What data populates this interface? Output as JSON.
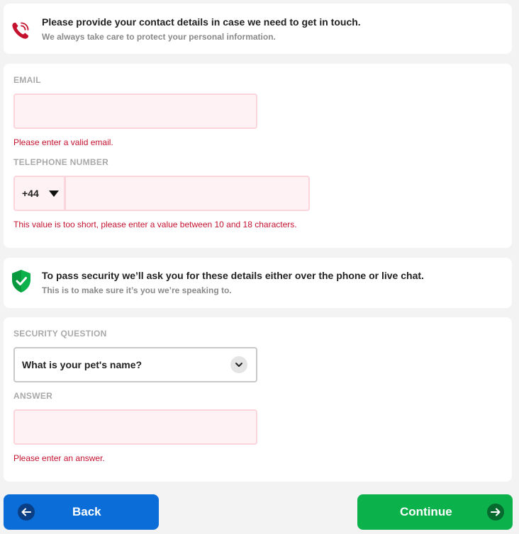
{
  "contact_info": {
    "title": "Please provide your contact details in case we need to get in touch.",
    "subtitle": "We always take care to protect your personal information.",
    "icon": "phone-icon"
  },
  "contact_form": {
    "email_label": "EMAIL",
    "email_value": "",
    "email_error": "Please enter a valid email.",
    "phone_label": "TELEPHONE NUMBER",
    "phone_country_code": "+44",
    "phone_value": "",
    "phone_error": "This value is too short, please enter a value between 10 and 18 characters."
  },
  "security_info": {
    "title": "To pass security we’ll ask you for these details either over the phone or live chat.",
    "subtitle": "This is to make sure it’s you we’re speaking to.",
    "icon": "shield-check-icon"
  },
  "security_form": {
    "question_label": "SECURITY QUESTION",
    "question_selected": "What is your pet's name?",
    "answer_label": "ANSWER",
    "answer_value": "",
    "answer_error": "Please enter an answer."
  },
  "navigation": {
    "back_label": "Back",
    "continue_label": "Continue"
  },
  "colors": {
    "back_button": "#0a6dd8",
    "continue_button": "#0bb14b",
    "error_text": "#c4122f",
    "error_field_bg": "#fff2f4",
    "phone_icon": "#c4122f",
    "shield_icon": "#0bb14b"
  }
}
